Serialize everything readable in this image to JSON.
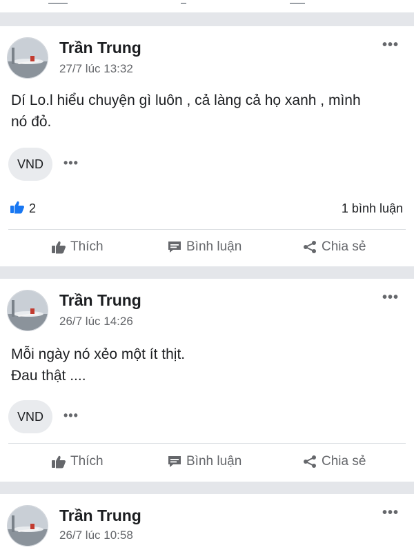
{
  "posts": [
    {
      "author": "Trần Trung",
      "time": "27/7 lúc 13:32",
      "text_lines": [
        "Dí Lo.l hiểu chuyện gì luôn , cả làng cả họ xanh , mình",
        "nó đỏ."
      ],
      "reaction_chip": "VND",
      "like_count": "2",
      "comment_count": "1 bình luận"
    },
    {
      "author": "Trần Trung",
      "time": "26/7 lúc 14:26",
      "text_lines": [
        "Mỗi ngày nó xẻo một ít thịt.",
        "Đau thật ...."
      ],
      "reaction_chip": "VND"
    },
    {
      "author": "Trần Trung",
      "time": "26/7 lúc 10:58"
    }
  ],
  "actions": {
    "like": "Thích",
    "comment": "Bình luận",
    "share": "Chia sẻ"
  },
  "more_glyph": "•••",
  "icons": [
    "thumbs-up-icon",
    "comment-icon",
    "share-icon",
    "more-options-icon",
    "like-reaction-icon"
  ],
  "colors": {
    "like_blue": "#1877f2",
    "text_secondary": "#65676b",
    "separator": "#e4e6ea"
  }
}
